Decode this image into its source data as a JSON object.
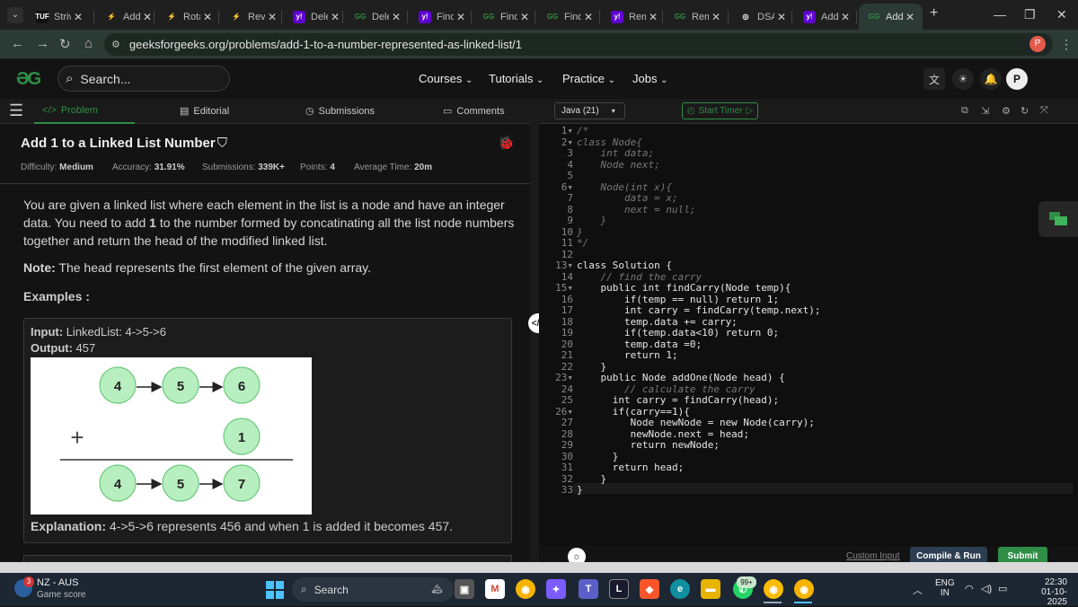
{
  "browser": {
    "tabs": [
      {
        "label": "Striv",
        "fav": "TUF",
        "fav_color": "#111111"
      },
      {
        "label": "Add",
        "fav": "⚡",
        "fav_color": "#1f1f1f"
      },
      {
        "label": "Rota",
        "fav": "⚡",
        "fav_color": "#1f1f1f"
      },
      {
        "label": "Reve",
        "fav": "⚡",
        "fav_color": "#1f1f1f"
      },
      {
        "label": "Dele",
        "fav": "y!",
        "fav_color": "#5f01d1"
      },
      {
        "label": "Dele",
        "fav": "GG",
        "fav_color": "#1f1f1f"
      },
      {
        "label": "Find",
        "fav": "y!",
        "fav_color": "#5f01d1"
      },
      {
        "label": "Find",
        "fav": "GG",
        "fav_color": "#1f1f1f"
      },
      {
        "label": "Find",
        "fav": "GG",
        "fav_color": "#1f1f1f"
      },
      {
        "label": "Rem",
        "fav": "y!",
        "fav_color": "#5f01d1"
      },
      {
        "label": "Rem",
        "fav": "GG",
        "fav_color": "#1f1f1f"
      },
      {
        "label": "DSA",
        "fav": "◎",
        "fav_color": "#1f1f1f"
      },
      {
        "label": "Add",
        "fav": "y!",
        "fav_color": "#5f01d1"
      },
      {
        "label": "Add",
        "fav": "GG",
        "fav_color": "#2b3a34"
      }
    ],
    "new_tab": "+",
    "url": "geeksforgeeks.org/problems/add-1-to-a-number-represented-as-linked-list/1",
    "profile_initial": "P"
  },
  "gfg": {
    "logo": "ƏG",
    "search_placeholder": "Search...",
    "nav": [
      "Courses",
      "Tutorials",
      "Practice",
      "Jobs"
    ],
    "avatar": "P"
  },
  "left": {
    "tabs": [
      "Problem",
      "Editorial",
      "Submissions",
      "Comments"
    ],
    "title": "Add 1 to a Linked List Number",
    "meta": {
      "difficulty_label": "Difficulty:",
      "difficulty": "Medium",
      "accuracy_label": "Accuracy:",
      "accuracy": "31.91%",
      "submissions_label": "Submissions:",
      "submissions": "339K+",
      "points_label": "Points:",
      "points": "4",
      "avg_label": "Average Time:",
      "avg": "20m"
    },
    "desc_parts": [
      "You are given a linked list where each element in the list is a node and have an integer data. You need to add ",
      "1",
      " to the number formed by concatinating all the list node numbers together and return the head of the modified linked list."
    ],
    "note_label": "Note:",
    "note": " The head represents the first element of the given array.",
    "examples_label": "Examples :",
    "input_label": "Input:",
    "input_value": " LinkedList: 4->5->6",
    "output_label": "Output:",
    "output_value": " 457",
    "diagram": {
      "row1": [
        "4",
        "5",
        "6"
      ],
      "plus": "+",
      "addend": "1",
      "row2": [
        "4",
        "5",
        "7"
      ]
    },
    "explanation_label": "Explanation:",
    "explanation": " 4->5->6 represents 456 and when 1 is added it becomes 457."
  },
  "editor": {
    "language": "Java (21)",
    "timer_label": "Start Timer",
    "line_count": 33,
    "custom_input": "Custom Input",
    "compile_label": "Compile & Run",
    "submit_label": "Submit"
  },
  "taskbar": {
    "weather_badge": "3",
    "weather_title": "NZ - AUS",
    "weather_sub": "Game score",
    "search_label": "Search",
    "lang_top": "ENG",
    "lang_bottom": "IN",
    "time": "22:30",
    "date": "01-10-2025",
    "badge": "99+"
  }
}
